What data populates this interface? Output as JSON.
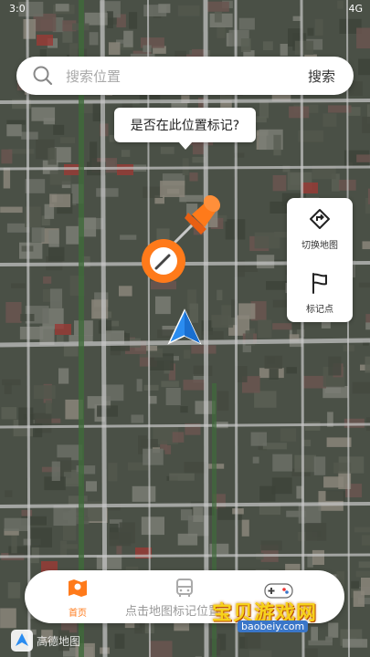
{
  "status": {
    "left": "3:0",
    "right": "4G"
  },
  "search": {
    "placeholder": "搜索位置",
    "button": "搜索"
  },
  "bubble": {
    "text": "是否在此位置标记?"
  },
  "panel": {
    "switch_map": "切换地图",
    "mark_point": "标记点"
  },
  "bottom": {
    "home": "首页",
    "hint": "点击地图标记位置"
  },
  "map_logo": "高德地图",
  "watermark": {
    "title": "宝贝游戏网",
    "url": "baobeiy.com"
  },
  "colors": {
    "accent": "#ff7a1a",
    "nav_arrow": "#2a8cf0"
  }
}
